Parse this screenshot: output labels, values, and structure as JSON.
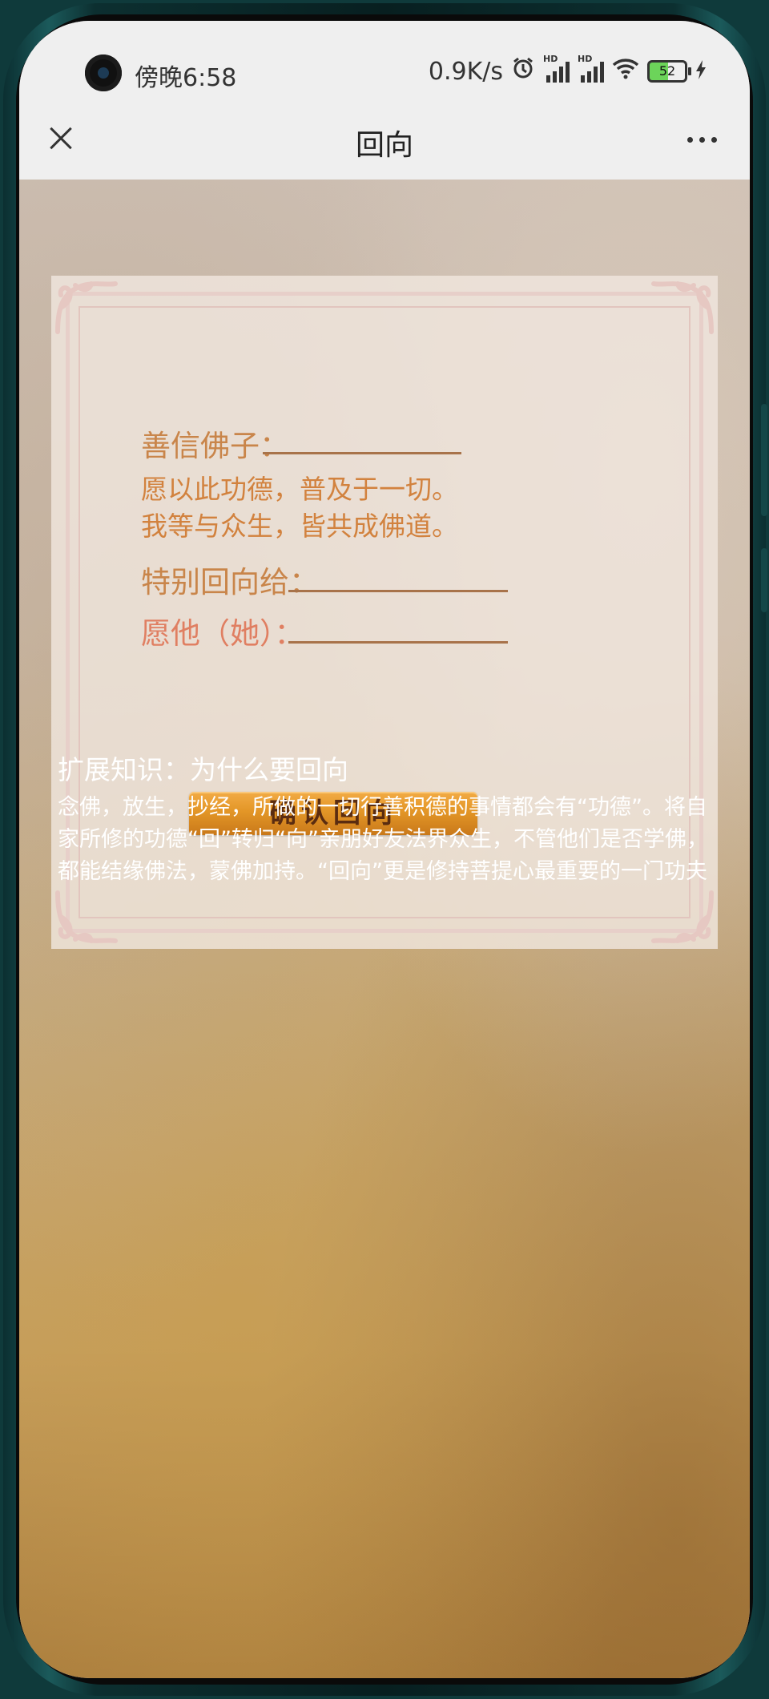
{
  "status_bar": {
    "time": "傍晚6:58",
    "network_speed": "0.9K/s",
    "alarm_icon": "alarm-icon",
    "signal_label_1": "HD",
    "signal_label_2": "HD",
    "wifi_icon": "wifi-icon",
    "battery_level": "52",
    "charging_icon": "charging-icon"
  },
  "nav": {
    "title": "回向",
    "close_icon": "close-icon",
    "more_icon": "more-icon"
  },
  "form": {
    "devotee_label": "善信佛子：",
    "devotee_value": "",
    "verse_line_1": "愿以此功德，普及于一切。",
    "verse_line_2": "我等与众生，皆共成佛道。",
    "dedicate_to_label": "特别回向给：",
    "dedicate_to_value": "",
    "wish_label": "愿他（她）：",
    "wish_value": "",
    "confirm_button": "确认回向"
  },
  "knowledge": {
    "title": "扩展知识：为什么要回向",
    "body": "念佛，放生，抄经，所做的一切行善积德的事情都会有“功德”。将自家所修的功德“回”转归“向”亲朋好友法界众生，不管他们是否学佛，都能结缘佛法，蒙佛加持。“回向”更是修持菩提心最重要的一门功夫"
  },
  "colors": {
    "label": "#c9854a",
    "verse": "#d2823e",
    "wish_label": "#e07f62",
    "button_gradient_top": "#f2ab45",
    "button_gradient_bottom": "#c9791a",
    "frame_border": "#e7cfc9"
  }
}
